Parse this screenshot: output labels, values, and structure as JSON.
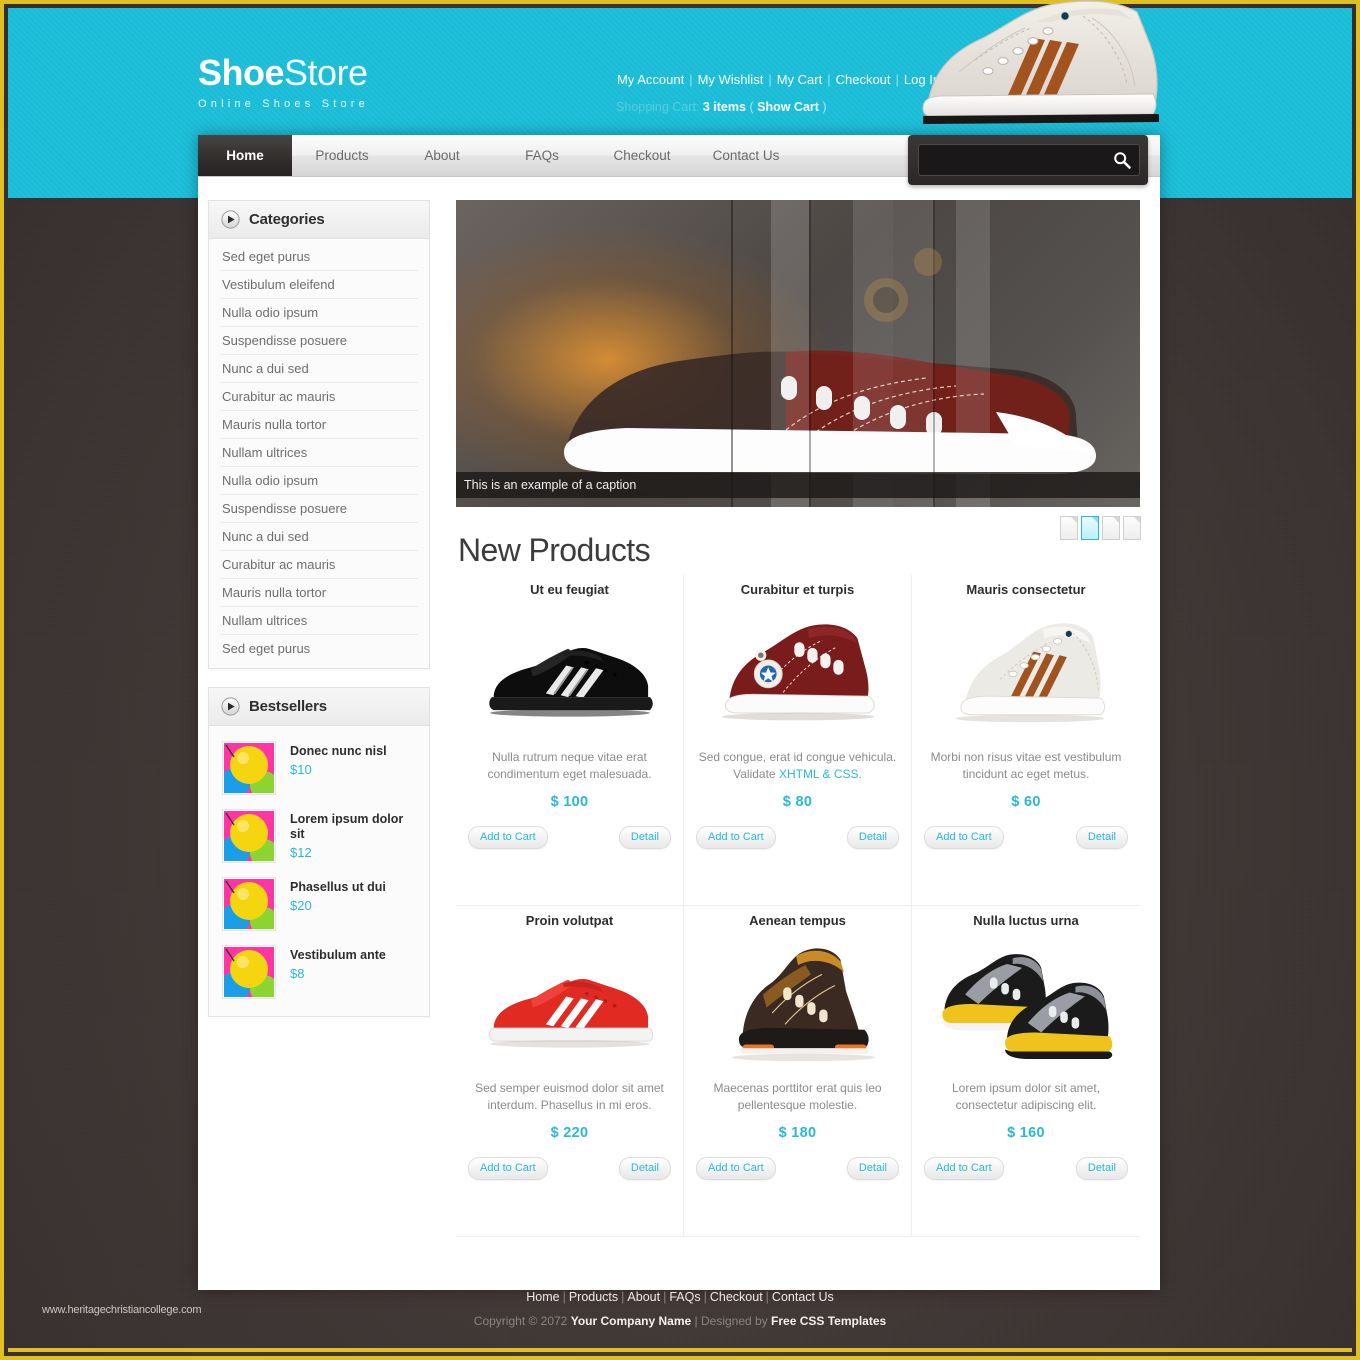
{
  "theme": {
    "accent_cyan": "#1cbfda",
    "price_cyan": "#2bb8d4",
    "frame_gold": "#e0c020",
    "page_bg": "#413937"
  },
  "header": {
    "logo_bold": "Shoe",
    "logo_light": "Store",
    "tagline": "Online Shoes Store",
    "top_links": [
      {
        "label": "My Account"
      },
      {
        "label": "My Wishlist"
      },
      {
        "label": "My Cart"
      },
      {
        "label": "Checkout"
      },
      {
        "label": "Log In"
      }
    ],
    "cart_label": "Shopping Cart:",
    "cart_items": "3 items",
    "cart_paren_open": "(",
    "cart_show": "Show Cart",
    "cart_paren_close": ")",
    "shoe_icon": "hightop-sneaker-icon"
  },
  "nav": {
    "items": [
      {
        "label": "Home",
        "active": true
      },
      {
        "label": "Products",
        "active": false
      },
      {
        "label": "About",
        "active": false
      },
      {
        "label": "FAQs",
        "active": false
      },
      {
        "label": "Checkout",
        "active": false
      },
      {
        "label": "Contact Us",
        "active": false
      }
    ]
  },
  "search": {
    "value": "",
    "placeholder": "",
    "icon": "search-icon"
  },
  "sidebar": {
    "categories": {
      "title": "Categories",
      "icon": "play-arrow-icon",
      "items": [
        "Sed eget purus",
        "Vestibulum eleifend",
        "Nulla odio ipsum",
        "Suspendisse posuere",
        "Nunc a dui sed",
        "Curabitur ac mauris",
        "Mauris nulla tortor",
        "Nullam ultrices",
        "Nulla odio ipsum",
        "Suspendisse posuere",
        "Nunc a dui sed",
        "Curabitur ac mauris",
        "Mauris nulla tortor",
        "Nullam ultrices",
        "Sed eget purus"
      ]
    },
    "bestsellers": {
      "title": "Bestsellers",
      "icon": "play-arrow-icon",
      "items": [
        {
          "title": "Donec nunc nisl",
          "price": "$10",
          "thumb": "balloons-thumbnail"
        },
        {
          "title": "Lorem ipsum dolor sit",
          "price": "$12",
          "thumb": "balloons-thumbnail"
        },
        {
          "title": "Phasellus ut dui",
          "price": "$20",
          "thumb": "balloons-thumbnail"
        },
        {
          "title": "Vestibulum ante",
          "price": "$8",
          "thumb": "balloons-thumbnail"
        }
      ]
    }
  },
  "slider": {
    "caption": "This is an example of a caption",
    "image": "red-sneaker-banner",
    "pages": [
      {
        "active": false
      },
      {
        "active": true
      },
      {
        "active": false
      },
      {
        "active": false
      }
    ]
  },
  "main": {
    "section_title": "New Products",
    "products": [
      {
        "title": "Ut eu feugiat",
        "desc": "Nulla rutrum neque vitae erat condimentum eget malesuada.",
        "price": "$ 100",
        "image": "black-sneaker-icon",
        "add_label": "Add to Cart",
        "detail_label": "Detail"
      },
      {
        "title": "Curabitur et turpis",
        "desc_pre": "Sed congue, erat id congue vehicula. Validate ",
        "desc_link": "XHTML & CSS",
        "desc_post": ".",
        "desc": "Sed congue, erat id congue vehicula. Validate XHTML & CSS.",
        "price": "$ 80",
        "image": "maroon-hightop-icon",
        "add_label": "Add to Cart",
        "detail_label": "Detail"
      },
      {
        "title": "Mauris consectetur",
        "desc": "Morbi non risus vitae est vestibulum tincidunt ac eget metus.",
        "price": "$ 60",
        "image": "cream-hightop-icon",
        "add_label": "Add to Cart",
        "detail_label": "Detail"
      },
      {
        "title": "Proin volutpat",
        "desc": "Sed semper euismod dolor sit amet interdum. Phasellus in mi eros.",
        "price": "$ 220",
        "image": "red-sneaker-icon",
        "add_label": "Add to Cart",
        "detail_label": "Detail"
      },
      {
        "title": "Aenean tempus",
        "desc": "Maecenas porttitor erat quis leo pellentesque molestie.",
        "price": "$ 180",
        "image": "brown-boot-icon",
        "add_label": "Add to Cart",
        "detail_label": "Detail"
      },
      {
        "title": "Nulla luctus urna",
        "desc": "Lorem ipsum dolor sit amet, consectetur adipiscing elit.",
        "price": "$ 160",
        "image": "grey-yellow-shoes-icon",
        "add_label": "Add to Cart",
        "detail_label": "Detail"
      }
    ]
  },
  "footer": {
    "links": [
      "Home",
      "Products",
      "About",
      "FAQs",
      "Checkout",
      "Contact Us"
    ],
    "copyright_pre": "Copyright © 2072",
    "company": "Your Company Name",
    "designed_by": "Designed by",
    "designer": "Free CSS Templates",
    "watermark": "www.heritagechristiancollege.com"
  }
}
